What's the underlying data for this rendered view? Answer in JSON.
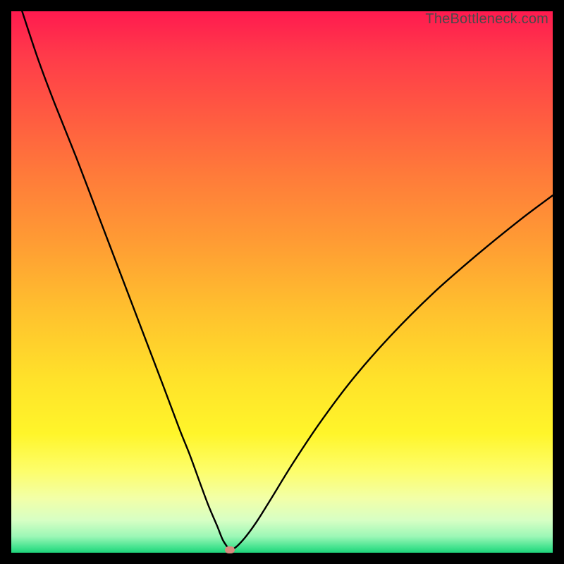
{
  "attribution": "TheBottleneck.com",
  "colors": {
    "curve_stroke": "#000000",
    "min_marker": "#d98a7e",
    "frame_bg": "#000000"
  },
  "chart_data": {
    "type": "line",
    "title": "",
    "xlabel": "",
    "ylabel": "",
    "xlim": [
      0,
      100
    ],
    "ylim": [
      0,
      100
    ],
    "grid": false,
    "legend": false,
    "series": [
      {
        "name": "bottleneck-curve",
        "x": [
          2,
          5,
          8,
          12,
          16,
          20,
          24,
          28,
          31,
          33,
          35,
          36.5,
          38,
          39,
          39.8,
          40.3,
          41,
          42,
          43.5,
          45.5,
          48,
          52,
          57,
          63,
          70,
          78,
          86,
          94,
          100
        ],
        "y": [
          100,
          91,
          83,
          73,
          62.5,
          52,
          41.5,
          31,
          23,
          18,
          12.5,
          8.5,
          5,
          2.5,
          1.2,
          0.5,
          0.7,
          1.5,
          3.2,
          6,
          10,
          16.5,
          24,
          32,
          40,
          48,
          55,
          61.5,
          66
        ]
      }
    ],
    "annotations": [
      {
        "name": "minimum-marker",
        "x": 40.3,
        "y": 0.5
      }
    ]
  }
}
